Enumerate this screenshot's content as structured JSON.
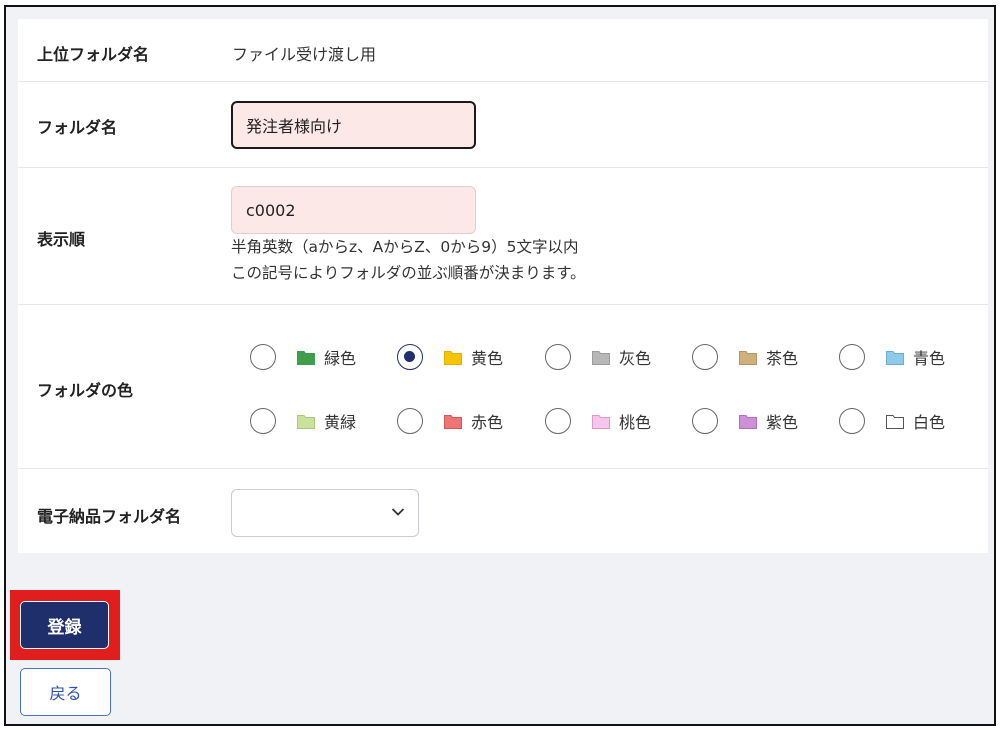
{
  "form": {
    "parent_folder": {
      "label": "上位フォルダ名",
      "value": "ファイル受け渡し用"
    },
    "folder_name": {
      "label": "フォルダ名",
      "value": "発注者様向け"
    },
    "display_order": {
      "label": "表示順",
      "value": "c0002",
      "help_line1": "半角英数（aからz、AからZ、0から9）5文字以内",
      "help_line2": "この記号によりフォルダの並ぶ順番が決まります。"
    },
    "folder_color": {
      "label": "フォルダの色",
      "selected": "黄色",
      "options": [
        {
          "label": "緑色",
          "color": "#3f9e4a"
        },
        {
          "label": "黄色",
          "color": "#f6c400"
        },
        {
          "label": "灰色",
          "color": "#b7b7b7"
        },
        {
          "label": "茶色",
          "color": "#cfb07a"
        },
        {
          "label": "青色",
          "color": "#8ecbea"
        },
        {
          "label": "黄緑",
          "color": "#c8e29b"
        },
        {
          "label": "赤色",
          "color": "#ef7575"
        },
        {
          "label": "桃色",
          "color": "#f7c4ee"
        },
        {
          "label": "紫色",
          "color": "#cf8fd7"
        },
        {
          "label": "白色",
          "color": "#ffffff"
        }
      ]
    },
    "e_delivery_folder": {
      "label": "電子納品フォルダ名",
      "value": ""
    }
  },
  "actions": {
    "register_label": "登録",
    "back_label": "戻る"
  }
}
